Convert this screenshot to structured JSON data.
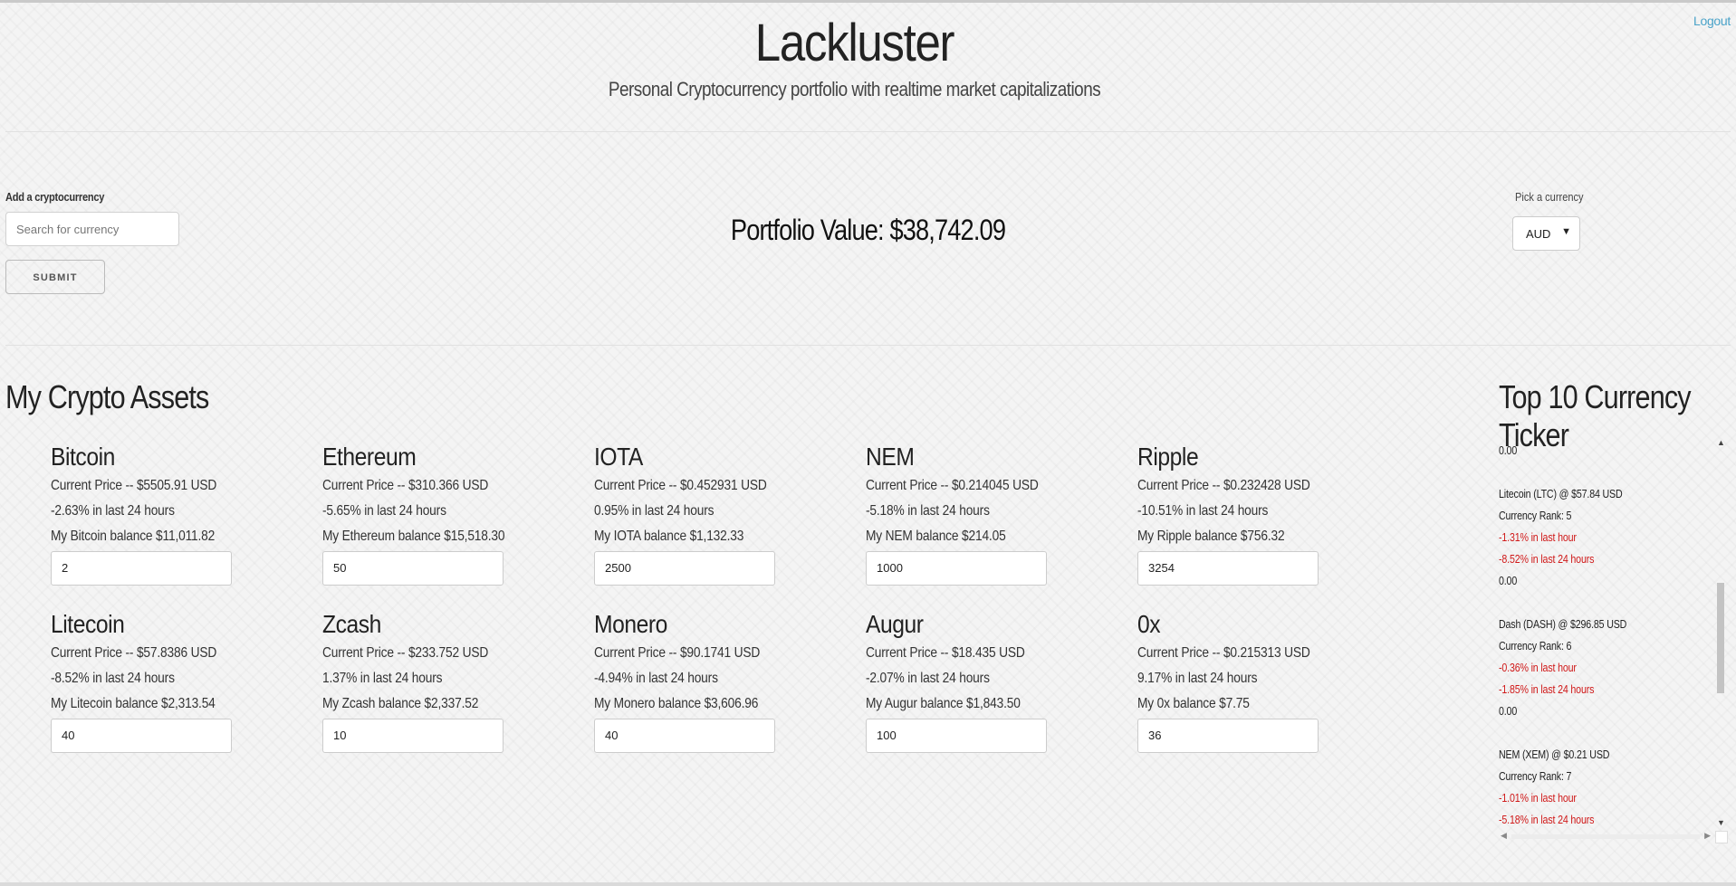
{
  "header": {
    "title": "Lackluster",
    "subtitle": "Personal Cryptocurrency portfolio with realtime market capitalizations",
    "logout_label": "Logout"
  },
  "add_form": {
    "label": "Add a cryptocurrency",
    "search_placeholder": "Search for currency",
    "submit_label": "SUBMIT"
  },
  "portfolio": {
    "value_text": "Portfolio Value: $38,742.09"
  },
  "currency_picker": {
    "label": "Pick a currency",
    "selected": "AUD"
  },
  "assets": {
    "title": "My Crypto Assets",
    "items": [
      {
        "name": "Bitcoin",
        "price": "Current Price -- $5505.91 USD",
        "change": "-2.63% in last 24 hours",
        "balance": "My Bitcoin balance $11,011.82",
        "qty": "2"
      },
      {
        "name": "Ethereum",
        "price": "Current Price -- $310.366 USD",
        "change": "-5.65% in last 24 hours",
        "balance": "My Ethereum balance $15,518.30",
        "qty": "50"
      },
      {
        "name": "IOTA",
        "price": "Current Price -- $0.452931 USD",
        "change": "0.95% in last 24 hours",
        "balance": "My IOTA balance $1,132.33",
        "qty": "2500"
      },
      {
        "name": "NEM",
        "price": "Current Price -- $0.214045 USD",
        "change": "-5.18% in last 24 hours",
        "balance": "My NEM balance $214.05",
        "qty": "1000"
      },
      {
        "name": "Ripple",
        "price": "Current Price -- $0.232428 USD",
        "change": "-10.51% in last 24 hours",
        "balance": "My Ripple balance $756.32",
        "qty": "3254"
      },
      {
        "name": "Litecoin",
        "price": "Current Price -- $57.8386 USD",
        "change": "-8.52% in last 24 hours",
        "balance": "My Litecoin balance $2,313.54",
        "qty": "40"
      },
      {
        "name": "Zcash",
        "price": "Current Price -- $233.752 USD",
        "change": "1.37% in last 24 hours",
        "balance": "My Zcash balance $2,337.52",
        "qty": "10"
      },
      {
        "name": "Monero",
        "price": "Current Price -- $90.1741 USD",
        "change": "-4.94% in last 24 hours",
        "balance": "My Monero balance $3,606.96",
        "qty": "40"
      },
      {
        "name": "Augur",
        "price": "Current Price -- $18.435 USD",
        "change": "-2.07% in last 24 hours",
        "balance": "My Augur balance $1,843.50",
        "qty": "100"
      },
      {
        "name": "0x",
        "price": "Current Price -- $0.215313 USD",
        "change": "9.17% in last 24 hours",
        "balance": "My 0x balance $7.75",
        "qty": "36"
      }
    ]
  },
  "ticker": {
    "title": "Top 10 Currency Ticker",
    "lead_value": "0.00",
    "items": [
      {
        "header": "Litecoin (LTC) @ $57.84 USD",
        "rank": "Currency Rank: 5",
        "hour": "-1.31% in last hour",
        "day": "-8.52% in last 24 hours",
        "extra": "0.00"
      },
      {
        "header": "Dash (DASH) @ $296.85 USD",
        "rank": "Currency Rank: 6",
        "hour": "-0.36% in last hour",
        "day": "-1.85% in last 24 hours",
        "extra": "0.00"
      },
      {
        "header": "NEM (XEM) @ $0.21 USD",
        "rank": "Currency Rank: 7",
        "hour": "-1.01% in last hour",
        "day": "-5.18% in last 24 hours",
        "extra": ""
      }
    ]
  },
  "colors": {
    "negative": "#d01a1a",
    "link": "#4aa3c9"
  }
}
